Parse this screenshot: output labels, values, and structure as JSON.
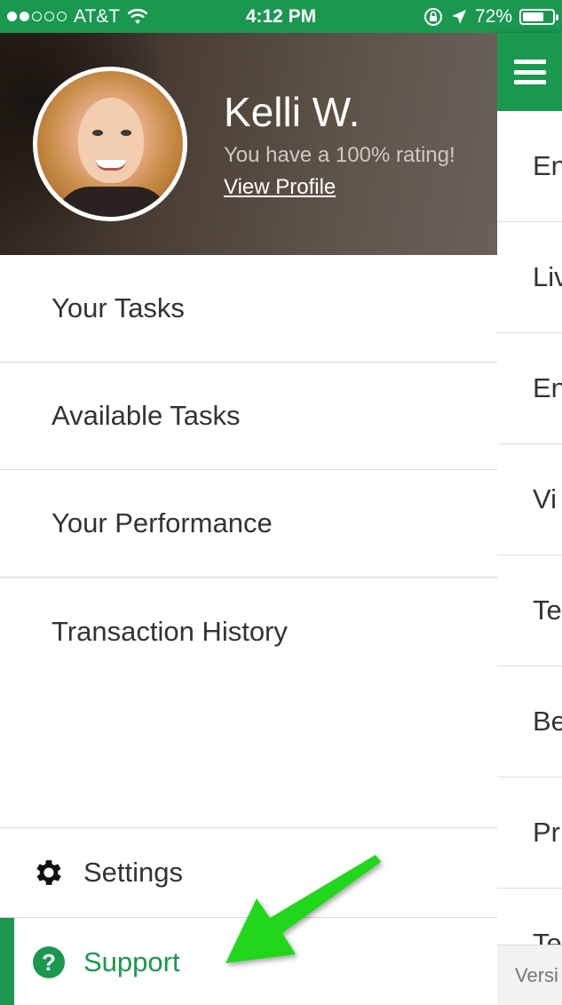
{
  "status_bar": {
    "carrier": "AT&T",
    "time": "4:12 PM",
    "battery_percent": "72%",
    "battery_level": 0.72,
    "signal_bars": 2
  },
  "profile": {
    "name": "Kelli W.",
    "rating_text": "You have a 100% rating!",
    "view_profile_label": "View Profile"
  },
  "menu": {
    "items": [
      {
        "label": "Your Tasks"
      },
      {
        "label": "Available Tasks"
      },
      {
        "label": "Your Performance"
      },
      {
        "label": "Transaction History"
      }
    ]
  },
  "bottom_menu": {
    "settings_label": "Settings",
    "support_label": "Support"
  },
  "right_panel": {
    "items": [
      {
        "label": "En"
      },
      {
        "label": "Liv"
      },
      {
        "label": "En"
      },
      {
        "label": "Vi"
      },
      {
        "label": "Te"
      },
      {
        "label": "Be"
      },
      {
        "label": "Pr"
      },
      {
        "label": "Te"
      }
    ],
    "footer": "Versi"
  },
  "colors": {
    "accent": "#1a9850",
    "annotation_arrow": "#22d61e"
  },
  "icons": {
    "settings": "gear-icon",
    "support": "help-circle-icon",
    "menu": "hamburger-icon"
  }
}
